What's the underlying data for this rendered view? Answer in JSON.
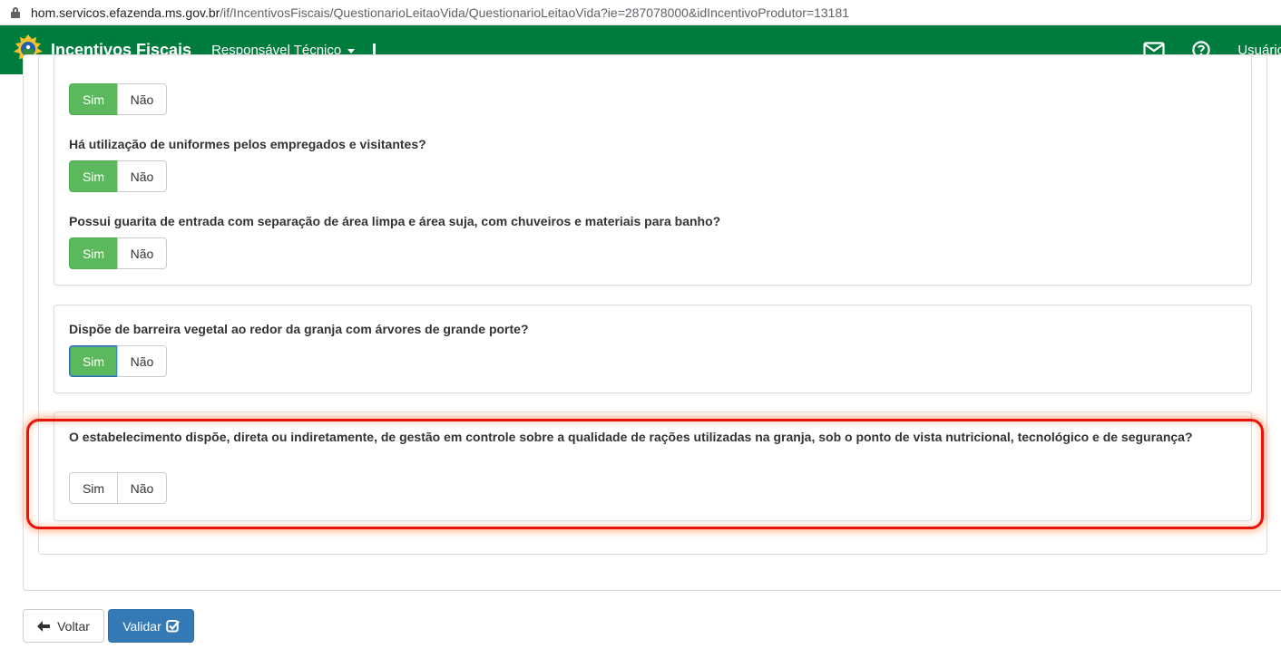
{
  "browser": {
    "url_host": "hom.servicos.efazenda.ms.gov.br",
    "url_path": "/if/IncentivosFiscais/QuestionarioLeitaoVida/QuestionarioLeitaoVida?ie=287078000&idIncentivoProdutor=13181"
  },
  "navbar": {
    "logo_icon": "state-coat-of-arms-icon",
    "title": "Incentivos Fiscais",
    "menu_label": "Responsável Técnico",
    "separator": "I",
    "mail_icon": "envelope-icon",
    "help_icon": "question-circle-icon",
    "user_label": "Usuário",
    "color": "#007c3e"
  },
  "questions": [
    {
      "text": "",
      "sim": "Sim",
      "nao": "Não",
      "selected": "Sim"
    },
    {
      "text": "Há utilização de uniformes pelos empregados e visitantes?",
      "sim": "Sim",
      "nao": "Não",
      "selected": "Sim"
    },
    {
      "text": "Possui guarita de entrada com separação de área limpa e área suja, com chuveiros e materiais para banho?",
      "sim": "Sim",
      "nao": "Não",
      "selected": "Sim"
    },
    {
      "text": "Dispõe de barreira vegetal ao redor da granja com árvores de grande porte?",
      "sim": "Sim",
      "nao": "Não",
      "selected": "Sim"
    },
    {
      "text": "O estabelecimento dispõe, direta ou indiretamente, de gestão em controle sobre a qualidade de rações utilizadas na granja, sob o ponto de vista nutricional, tecnológico e de segurança?",
      "sim": "Sim",
      "nao": "Não",
      "selected": null
    }
  ],
  "actions": {
    "back_label": "Voltar",
    "back_icon": "arrow-left-icon",
    "validate_label": "Validar",
    "validate_icon": "check-square-icon"
  },
  "colors": {
    "selected_green": "#5cb85c",
    "primary_blue": "#337ab7",
    "highlight_red": "#e8140b"
  }
}
